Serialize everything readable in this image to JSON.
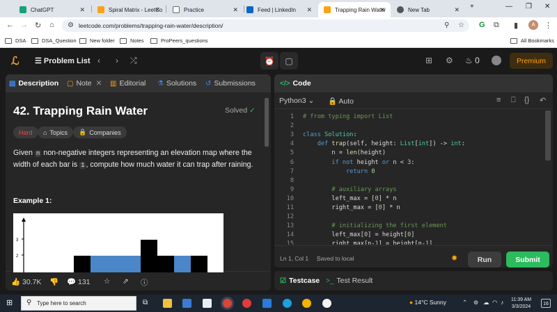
{
  "browser": {
    "tabs": [
      {
        "title": "ChatGPT",
        "color": "#10a37f"
      },
      {
        "title": "Spiral Matrix - LeetCo",
        "color": "#ffa116"
      },
      {
        "title": "Practice",
        "color": "#444444"
      },
      {
        "title": "Feed | LinkedIn",
        "color": "#0a66c2"
      },
      {
        "title": "Trapping Rain Water",
        "color": "#ffa116"
      },
      {
        "title": "New Tab",
        "color": "#555555"
      }
    ],
    "url": "leetcode.com/problems/trapping-rain-water/description/",
    "profile_initial": "A",
    "bookmarks": [
      "DSA",
      "DSA_Question",
      "New folder",
      "Notes",
      "ProPeers_questions"
    ],
    "all_bookmarks": "All Bookmarks"
  },
  "header": {
    "problem_list": "Problem List",
    "streak": "0",
    "premium": "Premium"
  },
  "left_panel": {
    "tabs": [
      "Description",
      "Note",
      "Editorial",
      "Solutions",
      "Submissions"
    ],
    "title": "42. Trapping Rain Water",
    "status": "Solved",
    "difficulty": "Hard",
    "topics": "Topics",
    "companies": "Companies",
    "text_parts": [
      "Given ",
      "n",
      " non-negative integers representing an elevation map where the width of each bar is ",
      "1",
      ", compute how much water it can trap after raining."
    ],
    "example_title": "Example 1:",
    "figure_ticks": [
      "3",
      "2"
    ],
    "likes": "30.7K",
    "comments": "131"
  },
  "code_panel": {
    "title": "Code",
    "language": "Python3",
    "mode": "Auto",
    "lines": [
      {
        "n": "1",
        "html": "<span class='cm'># from typing import List</span>"
      },
      {
        "n": "2",
        "html": ""
      },
      {
        "n": "3",
        "html": "<span class='k'>class</span> <span class='cl'>Solution</span>:"
      },
      {
        "n": "4",
        "html": "    <span class='k'>def</span> <span class='f'>trap</span>(self, height: <span class='cl'>List</span>[<span class='cl'>int</span>]) -> <span class='cl'>int</span>:"
      },
      {
        "n": "5",
        "html": "        n = <span class='f'>len</span>(height)"
      },
      {
        "n": "6",
        "html": "        <span class='k'>if not</span> height <span class='k'>or</span> n &lt; <span class='n'>3</span>:"
      },
      {
        "n": "7",
        "html": "            <span class='k'>return</span> <span class='n'>0</span>"
      },
      {
        "n": "8",
        "html": ""
      },
      {
        "n": "9",
        "html": "        <span class='cm'># auxiliary arrays</span>"
      },
      {
        "n": "10",
        "html": "        left_max = [<span class='n'>0</span>] * n"
      },
      {
        "n": "11",
        "html": "        right_max = [<span class='n'>0</span>] * n"
      },
      {
        "n": "12",
        "html": ""
      },
      {
        "n": "13",
        "html": "        <span class='cm'># initializing the first element</span>"
      },
      {
        "n": "14",
        "html": "        left_max[<span class='n'>0</span>] = height[<span class='n'>0</span>]"
      },
      {
        "n": "15",
        "html": "        right_max[n-<span class='n'>1</span>] = height[n-<span class='n'>1</span>]"
      }
    ],
    "cursor": "Ln 1, Col 1",
    "saved": "Saved to local",
    "run": "Run",
    "submit": "Submit",
    "testcase": "Testcase",
    "test_result": "Test Result"
  },
  "taskbar": {
    "search_placeholder": "Type here to search",
    "weather": "14°C  Sunny",
    "time": "11:39 AM",
    "date": "3/3/2024",
    "notifications": "16"
  }
}
